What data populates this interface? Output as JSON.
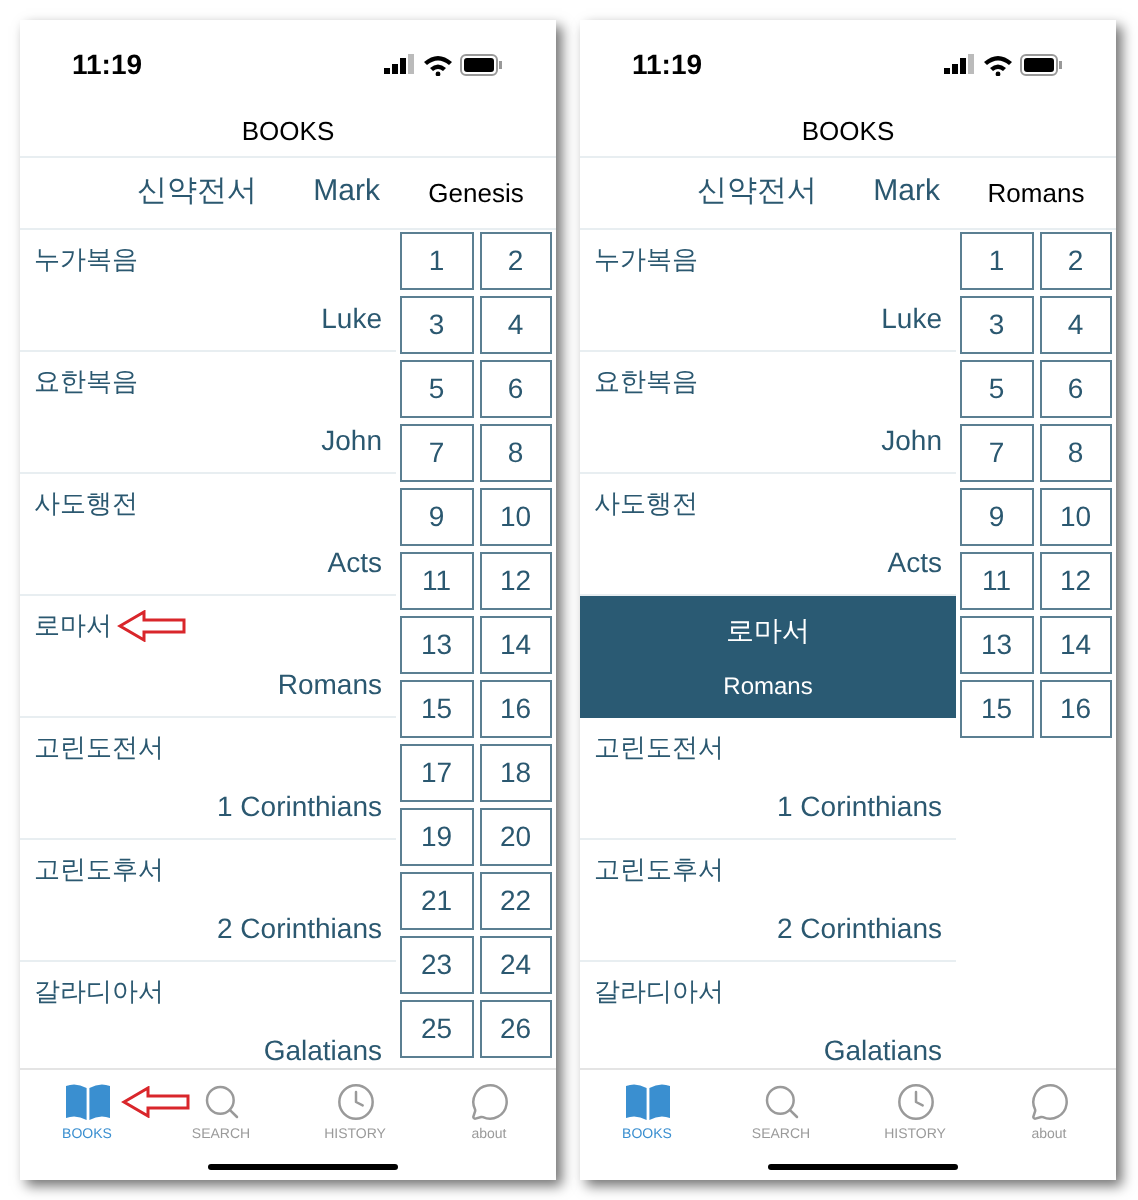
{
  "phones": [
    {
      "time": "11:19",
      "title": "BOOKS",
      "header": {
        "testament": "신약전서",
        "book": "Mark",
        "chapter_book": "Genesis"
      },
      "books": [
        {
          "korean": "누가복음",
          "english": "Luke",
          "selected": false,
          "arrow": false
        },
        {
          "korean": "요한복음",
          "english": "John",
          "selected": false,
          "arrow": false
        },
        {
          "korean": "사도행전",
          "english": "Acts",
          "selected": false,
          "arrow": false
        },
        {
          "korean": "로마서",
          "english": "Romans",
          "selected": false,
          "arrow": true
        },
        {
          "korean": "고린도전서",
          "english": "1 Corinthians",
          "selected": false,
          "arrow": false
        },
        {
          "korean": "고린도후서",
          "english": "2 Corinthians",
          "selected": false,
          "arrow": false
        },
        {
          "korean": "갈라디아서",
          "english": "Galatians",
          "selected": false,
          "arrow": false
        }
      ],
      "chapters": [
        "1",
        "2",
        "3",
        "4",
        "5",
        "6",
        "7",
        "8",
        "9",
        "10",
        "11",
        "12",
        "13",
        "14",
        "15",
        "16",
        "17",
        "18",
        "19",
        "20",
        "21",
        "22",
        "23",
        "24",
        "25",
        "26"
      ],
      "tabs": [
        {
          "kind": "book",
          "label": "BOOKS",
          "selected": true,
          "arrow": true
        },
        {
          "kind": "search",
          "label": "SEARCH",
          "selected": false,
          "arrow": false
        },
        {
          "kind": "history",
          "label": "HISTORY",
          "selected": false,
          "arrow": false
        },
        {
          "kind": "chat",
          "label": "about",
          "selected": false,
          "arrow": false
        }
      ]
    },
    {
      "time": "11:19",
      "title": "BOOKS",
      "header": {
        "testament": "신약전서",
        "book": "Mark",
        "chapter_book": "Romans"
      },
      "books": [
        {
          "korean": "누가복음",
          "english": "Luke",
          "selected": false,
          "arrow": false
        },
        {
          "korean": "요한복음",
          "english": "John",
          "selected": false,
          "arrow": false
        },
        {
          "korean": "사도행전",
          "english": "Acts",
          "selected": false,
          "arrow": false
        },
        {
          "korean": "로마서",
          "english": "Romans",
          "selected": true,
          "arrow": false
        },
        {
          "korean": "고린도전서",
          "english": "1 Corinthians",
          "selected": false,
          "arrow": false
        },
        {
          "korean": "고린도후서",
          "english": "2 Corinthians",
          "selected": false,
          "arrow": false
        },
        {
          "korean": "갈라디아서",
          "english": "Galatians",
          "selected": false,
          "arrow": false
        }
      ],
      "chapters": [
        "1",
        "2",
        "3",
        "4",
        "5",
        "6",
        "7",
        "8",
        "9",
        "10",
        "11",
        "12",
        "13",
        "14",
        "15",
        "16"
      ],
      "tabs": [
        {
          "kind": "book",
          "label": "BOOKS",
          "selected": true,
          "arrow": false
        },
        {
          "kind": "search",
          "label": "SEARCH",
          "selected": false,
          "arrow": false
        },
        {
          "kind": "history",
          "label": "HISTORY",
          "selected": false,
          "arrow": false
        },
        {
          "kind": "chat",
          "label": "about",
          "selected": false,
          "arrow": false
        }
      ]
    }
  ]
}
